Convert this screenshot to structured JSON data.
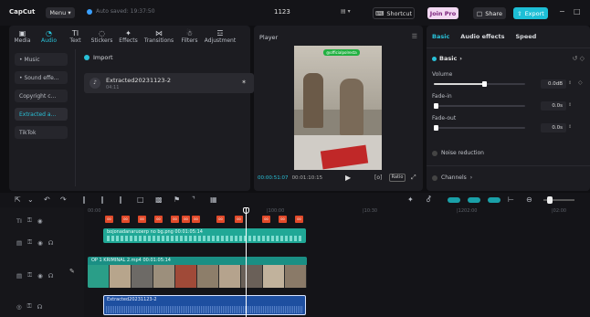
{
  "titlebar": {
    "logo": "CapCut",
    "menu_label": "Menu",
    "autosave_text": "Auto saved: 19:37:50",
    "project_title": "1123",
    "shortcut_label": "Shortcut",
    "join_pro_label": "Join Pro",
    "share_label": "Share",
    "export_label": "Export",
    "minimize": "−",
    "maximize": "□"
  },
  "media_toolbar": {
    "tabs": [
      {
        "icon": "▣",
        "label": "Media"
      },
      {
        "icon": "◔",
        "label": "Audio"
      },
      {
        "icon": "TI",
        "label": "Text"
      },
      {
        "icon": "◌",
        "label": "Stickers"
      },
      {
        "icon": "✦",
        "label": "Effects"
      },
      {
        "icon": "⋈",
        "label": "Transitions"
      },
      {
        "icon": "☃",
        "label": "Filters"
      },
      {
        "icon": "☲",
        "label": "Adjustment"
      }
    ],
    "active_tab": "Audio"
  },
  "audio_sidebar": {
    "items": [
      "• Music",
      "• Sound effe...",
      "Copyright c...",
      "Extracted a...",
      "TikTok"
    ],
    "active_item": "Extracted a..."
  },
  "media_panel": {
    "import_label": "Import",
    "asset": {
      "name": "Extracted20231123-2",
      "duration": "04:11"
    }
  },
  "player": {
    "title": "Player",
    "current_time": "00:00:51:07",
    "total_time": "00:01:10:15",
    "ratio_label": "Ratio",
    "overlay_text": "@officialpolresta"
  },
  "inspector": {
    "tabs": [
      "Basic",
      "Audio effects",
      "Speed"
    ],
    "active_tab": "Basic",
    "section_title": "Basic",
    "volume_label": "Volume",
    "volume_value": "0.0dB",
    "volume_level": 0.55,
    "fade_in_label": "Fade-in",
    "fade_in_value": "0.0s",
    "fade_out_label": "Fade-out",
    "fade_out_value": "0.0s",
    "noise_label": "Noise reduction",
    "channels_label": "Channels"
  },
  "timeline": {
    "ruler_ticks": [
      "00:00",
      "|100:00",
      "|10:30",
      "|1202:00",
      "|02:00"
    ],
    "image_clip_label": "bojonadanaruoerp no bg.png  00:01:05:14",
    "video_clip_label": "OP 1  KRIMINAL 2.mp4  00:01:05:14",
    "audio_clip_label": "Extracted20231123-2"
  }
}
